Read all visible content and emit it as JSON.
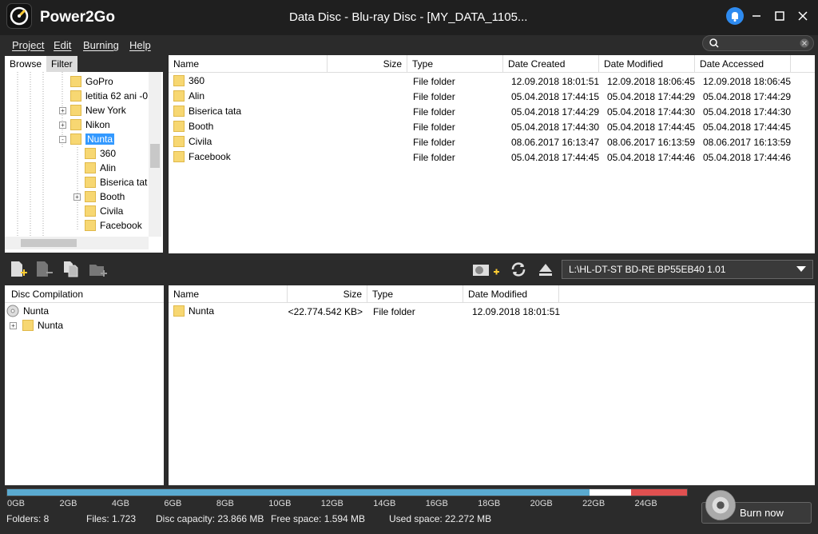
{
  "app": {
    "name": "Power2Go",
    "window_title": "Data Disc - Blu-ray Disc - [MY_DATA_1105..."
  },
  "menu": [
    "Project",
    "Edit",
    "Burning",
    "Help"
  ],
  "tabs": {
    "browse": "Browse",
    "filter": "Filter"
  },
  "tree": [
    {
      "label": "GoPro",
      "level": 1,
      "expander": ""
    },
    {
      "label": "letitia 62 ani -0",
      "level": 1,
      "expander": ""
    },
    {
      "label": "New York",
      "level": 1,
      "expander": "+"
    },
    {
      "label": "Nikon",
      "level": 1,
      "expander": "+"
    },
    {
      "label": "Nunta",
      "level": 1,
      "expander": "-",
      "selected": true
    },
    {
      "label": "360",
      "level": 2,
      "expander": ""
    },
    {
      "label": "Alin",
      "level": 2,
      "expander": ""
    },
    {
      "label": "Biserica tat",
      "level": 2,
      "expander": ""
    },
    {
      "label": "Booth",
      "level": 2,
      "expander": "+"
    },
    {
      "label": "Civila",
      "level": 2,
      "expander": ""
    },
    {
      "label": "Facebook",
      "level": 2,
      "expander": ""
    }
  ],
  "file_list": {
    "columns": [
      "Name",
      "Size",
      "Type",
      "Date Created",
      "Date Modified",
      "Date Accessed"
    ],
    "rows": [
      {
        "name": "360",
        "size": "",
        "type": "File folder",
        "created": "12.09.2018 18:01:51",
        "modified": "12.09.2018 18:06:45",
        "accessed": "12.09.2018 18:06:45"
      },
      {
        "name": "Alin",
        "size": "",
        "type": "File folder",
        "created": "05.04.2018 17:44:15",
        "modified": "05.04.2018 17:44:29",
        "accessed": "05.04.2018 17:44:29"
      },
      {
        "name": "Biserica tata",
        "size": "",
        "type": "File folder",
        "created": "05.04.2018 17:44:29",
        "modified": "05.04.2018 17:44:30",
        "accessed": "05.04.2018 17:44:30"
      },
      {
        "name": "Booth",
        "size": "",
        "type": "File folder",
        "created": "05.04.2018 17:44:30",
        "modified": "05.04.2018 17:44:45",
        "accessed": "05.04.2018 17:44:45"
      },
      {
        "name": "Civila",
        "size": "",
        "type": "File folder",
        "created": "08.06.2017 16:13:47",
        "modified": "08.06.2017 16:13:59",
        "accessed": "08.06.2017 16:13:59"
      },
      {
        "name": "Facebook",
        "size": "",
        "type": "File folder",
        "created": "05.04.2018 17:44:45",
        "modified": "05.04.2018 17:44:46",
        "accessed": "05.04.2018 17:44:46"
      }
    ]
  },
  "drive": "L:\\HL-DT-ST BD-RE BP55EB40 1.01",
  "compilation": {
    "header": "Disc Compilation",
    "root": "Nunta",
    "child": "Nunta",
    "columns": [
      "Name",
      "Size",
      "Type",
      "Date Modified"
    ],
    "rows": [
      {
        "name": "Nunta",
        "size": "<22.774.542 KB>",
        "type": "File folder",
        "modified": "12.09.2018 18:01:51"
      }
    ]
  },
  "capacity_bar": {
    "ticks": [
      "0GB",
      "2GB",
      "4GB",
      "6GB",
      "8GB",
      "10GB",
      "12GB",
      "14GB",
      "16GB",
      "18GB",
      "20GB",
      "22GB",
      "24GB"
    ],
    "used_gb": 22.272,
    "capacity_gb": 23.866
  },
  "stats": {
    "folders": "Folders:  8",
    "files": "Files:  1.723",
    "disc_capacity": "Disc capacity:  23.866 MB",
    "free_space": "Free space:  1.594 MB",
    "used_space": "Used space:  22.272 MB"
  },
  "burn_button": "Burn now"
}
